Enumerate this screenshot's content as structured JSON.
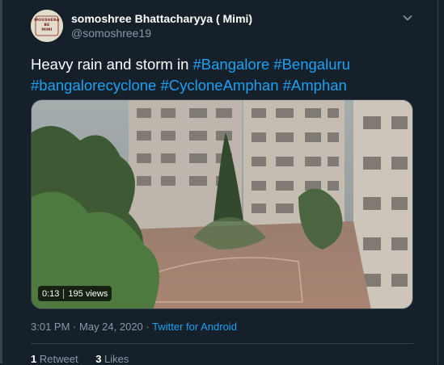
{
  "author": {
    "display_name": "somoshree Bhattacharyya ( Mimi)",
    "handle": "@somoshree19",
    "avatar_text_lines": [
      "MOUSHERA",
      "BE",
      "MIMI"
    ]
  },
  "tweet": {
    "text_prefix": "Heavy rain and storm in ",
    "hashtags": [
      "#Bangalore",
      "#Bengaluru",
      "#bangalorecyclone",
      "#CycloneAmphan",
      "#Amphan"
    ]
  },
  "media": {
    "type": "video",
    "duration": "0:13",
    "views": "195 views"
  },
  "meta": {
    "time": "3:01 PM",
    "separator": "·",
    "date": "May 24, 2020",
    "source": "Twitter for Android"
  },
  "stats": {
    "retweets_count": "1",
    "retweets_label": "Retweet",
    "likes_count": "3",
    "likes_label": "Likes"
  },
  "icons": {
    "menu": "chevron-down-icon"
  },
  "colors": {
    "background": "#15202b",
    "link": "#1da1f2",
    "muted": "#8899a6",
    "border": "#38444d"
  }
}
